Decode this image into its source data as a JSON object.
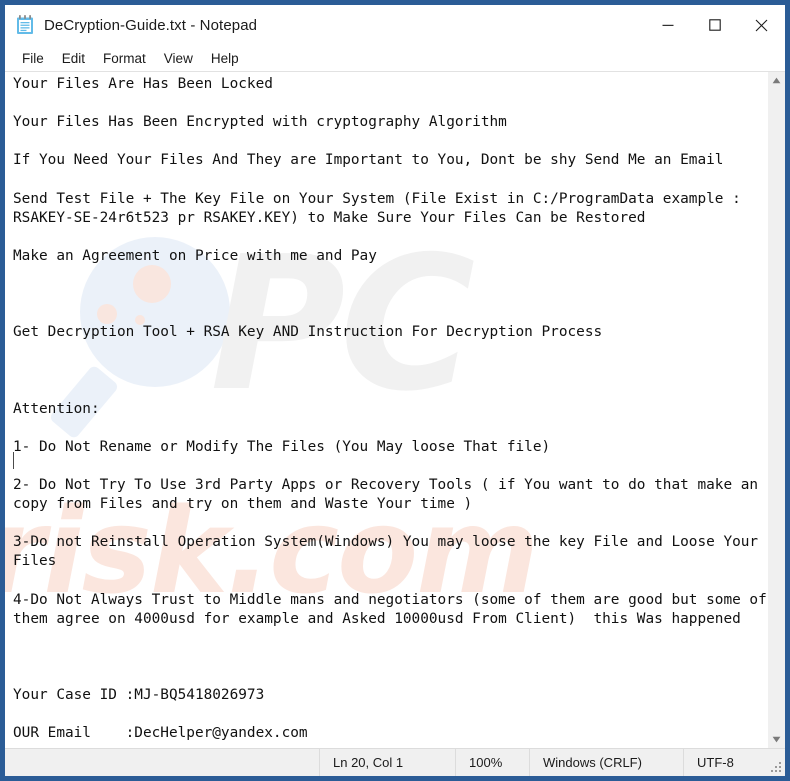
{
  "window": {
    "title": "DeCryption-Guide.txt - Notepad",
    "icon": "notepad-icon",
    "border_color": "#2b5c96",
    "controls": [
      {
        "name": "minimize",
        "glyph": "minimize-icon"
      },
      {
        "name": "maximize",
        "glyph": "maximize-icon"
      },
      {
        "name": "close",
        "glyph": "close-icon"
      }
    ]
  },
  "menu": {
    "items": [
      {
        "label": "File"
      },
      {
        "label": "Edit"
      },
      {
        "label": "Format"
      },
      {
        "label": "View"
      },
      {
        "label": "Help"
      }
    ]
  },
  "document": {
    "text": "Your Files Are Has Been Locked\n\nYour Files Has Been Encrypted with cryptography Algorithm\n\nIf You Need Your Files And They are Important to You, Dont be shy Send Me an Email\n\nSend Test File + The Key File on Your System (File Exist in C:/ProgramData example : RSAKEY-SE-24r6t523 pr RSAKEY.KEY) to Make Sure Your Files Can be Restored\n\nMake an Agreement on Price with me and Pay\n\n\n\nGet Decryption Tool + RSA Key AND Instruction For Decryption Process\n\n\n\nAttention:\n\n1- Do Not Rename or Modify The Files (You May loose That file)\n\n2- Do Not Try To Use 3rd Party Apps or Recovery Tools ( if You want to do that make an copy from Files and try on them and Waste Your time )\n\n3-Do not Reinstall Operation System(Windows) You may loose the key File and Loose Your Files\n\n4-Do Not Always Trust to Middle mans and negotiators (some of them are good but some of them agree on 4000usd for example and Asked 10000usd From Client)  this Was happened\n\n\n\nYour Case ID :MJ-BQ5418026973\n\nOUR Email    :DecHelper@yandex.com"
  },
  "watermarks": {
    "brand_letters": "PC",
    "site_text": "risk.com",
    "brand_color": "#f1f1f1",
    "site_color": "#fbe6de",
    "magnifier_color": "#e8eef8"
  },
  "scrollbar": {
    "up_arrow": "scroll-up-icon",
    "down_arrow": "scroll-down-icon"
  },
  "status_bar": {
    "position": "Ln 20, Col 1",
    "zoom": "100%",
    "line_ending": "Windows (CRLF)",
    "encoding": "UTF-8"
  }
}
